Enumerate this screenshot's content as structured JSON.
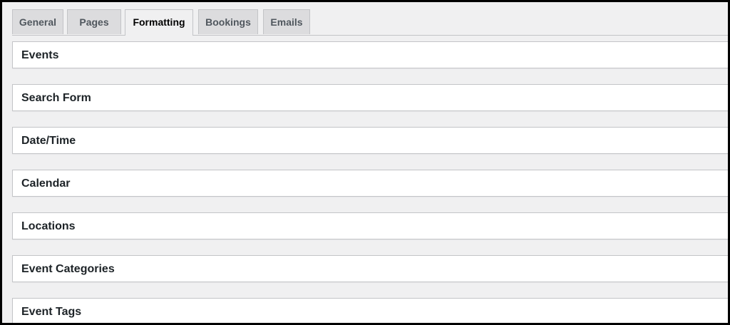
{
  "tabs": [
    {
      "label": "General",
      "active": false
    },
    {
      "label": "Pages",
      "active": false
    },
    {
      "label": "Formatting",
      "active": true
    },
    {
      "label": "Bookings",
      "active": false
    },
    {
      "label": "Emails",
      "active": false
    }
  ],
  "panels": [
    {
      "title": "Events"
    },
    {
      "title": "Search Form"
    },
    {
      "title": "Date/Time"
    },
    {
      "title": "Calendar"
    },
    {
      "title": "Locations"
    },
    {
      "title": "Event Categories"
    },
    {
      "title": "Event Tags"
    }
  ],
  "colors": {
    "background": "#f0f0f1",
    "tab_inactive": "#dcdcde",
    "border": "#c3c4c7",
    "panel": "#ffffff"
  }
}
